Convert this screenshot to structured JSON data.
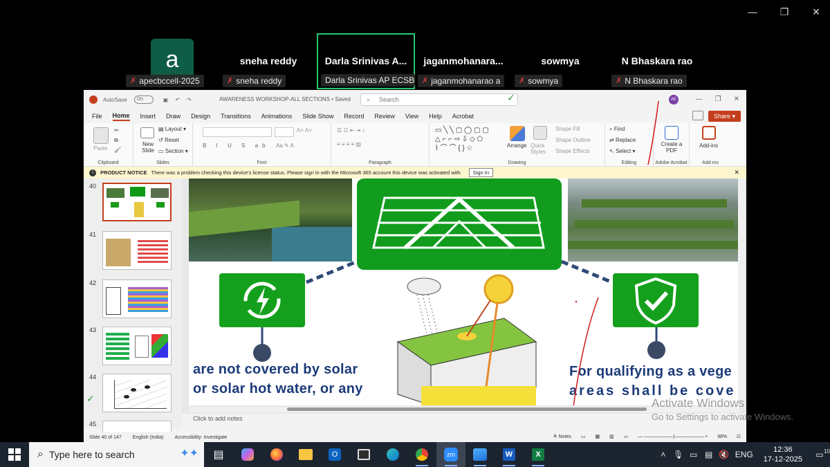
{
  "window_controls": {
    "minimize": "—",
    "restore": "❐",
    "close": "✕"
  },
  "participants": [
    {
      "name": "",
      "label": "apecbccell-2025",
      "avatar_letter": "a"
    },
    {
      "name": "sneha reddy",
      "label": "sneha reddy"
    },
    {
      "name": "Darla Srinivas A...",
      "label": "Darla Srinivas AP ECSBC ...",
      "active": true
    },
    {
      "name": "jaganmohanara...",
      "label": "jaganmohanarao a"
    },
    {
      "name": "sowmya",
      "label": "sowmya"
    },
    {
      "name": "N Bhaskara rao",
      "label": "N Bhaskara rao"
    }
  ],
  "ppt": {
    "autosave_label": "AutoSave",
    "autosave_state": "On",
    "doc_title": "AWARENESS WORKSHOP-ALL SECTIONS • Saved",
    "search_placeholder": "Search",
    "user_initials": "AE",
    "menu": [
      "File",
      "Home",
      "Insert",
      "Draw",
      "Design",
      "Transitions",
      "Animations",
      "Slide Show",
      "Record",
      "Review",
      "View",
      "Help",
      "Acrobat"
    ],
    "active_menu": "Home",
    "share_label": "Share",
    "ribbon": {
      "clipboard": {
        "title": "Clipboard",
        "paste": "Paste"
      },
      "slides": {
        "title": "Slides",
        "new_slide": "New Slide",
        "layout": "Layout",
        "reset": "Reset",
        "section": "Section"
      },
      "font": {
        "title": "Font"
      },
      "paragraph": {
        "title": "Paragraph"
      },
      "drawing": {
        "title": "Drawing",
        "arrange": "Arrange",
        "quick_styles": "Quick Styles",
        "shape_fill": "Shape Fill",
        "shape_outline": "Shape Outline",
        "shape_effects": "Shape Effects"
      },
      "editing": {
        "title": "Editing",
        "find": "Find",
        "replace": "Replace",
        "select": "Select"
      },
      "adobe": {
        "title": "Adobe Acrobat",
        "create_pdf": "Create a PDF"
      },
      "addins": {
        "title": "Add-ins",
        "addins": "Add-ins"
      }
    },
    "notice": {
      "title": "PRODUCT NOTICE",
      "message": "There was a problem checking this device's license status. Please sign in with the Microsoft 365 account this device was activated with.",
      "button": "Sign In"
    },
    "thumbnails": [
      {
        "num": "40",
        "selected": true
      },
      {
        "num": "41"
      },
      {
        "num": "42"
      },
      {
        "num": "43"
      },
      {
        "num": "44"
      },
      {
        "num": "45"
      }
    ],
    "slide": {
      "left_text_1": "are not covered by solar",
      "left_text_2": "or solar hot water, or any",
      "right_text_1": "For qualifying as a vege",
      "right_text_2": "areas shall be cove"
    },
    "notes_placeholder": "Click to add notes",
    "status": {
      "slide_info": "Slide 40 of 147",
      "language": "English (India)",
      "accessibility": "Accessibility: Investigate",
      "notes": "Notes",
      "zoom": "98%"
    },
    "watermark": {
      "line1": "Activate Windows",
      "line2": "Go to Settings to activate Windows."
    }
  },
  "taskbar": {
    "search_text": "Type here to search",
    "apps": [
      "task-view",
      "copilot",
      "firefox",
      "file-explorer",
      "outlook",
      "store",
      "edge",
      "chrome",
      "zoom",
      "photos",
      "word",
      "excel"
    ],
    "language": "ENG",
    "time": "12:36",
    "date": "17-12-2025",
    "notification_count": "10"
  }
}
